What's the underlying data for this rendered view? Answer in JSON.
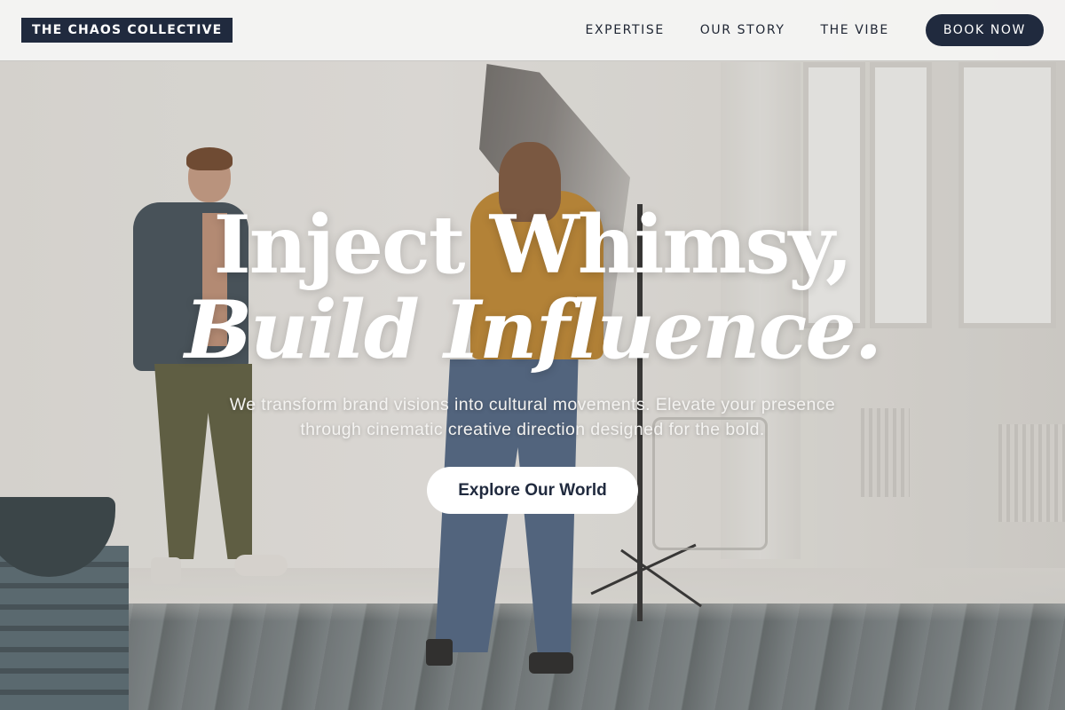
{
  "navbar": {
    "brand": "THE CHAOS COLLECTIVE",
    "links": [
      "EXPERTISE",
      "OUR STORY",
      "THE VIBE"
    ],
    "cta_label": "BOOK NOW"
  },
  "hero": {
    "headline_line1": "Inject Whimsy,",
    "headline_line2": "Build Influence.",
    "subtitle": "We transform brand visions into cultural movements. Elevate your presence through cinematic creative direction designed for the bold.",
    "cta_label": "Explore Our World",
    "background_image": "photo-studio-photoshoot"
  },
  "colors": {
    "navy": "#202a3e",
    "white": "#ffffff",
    "nav_bg": "#f4f4f3"
  }
}
